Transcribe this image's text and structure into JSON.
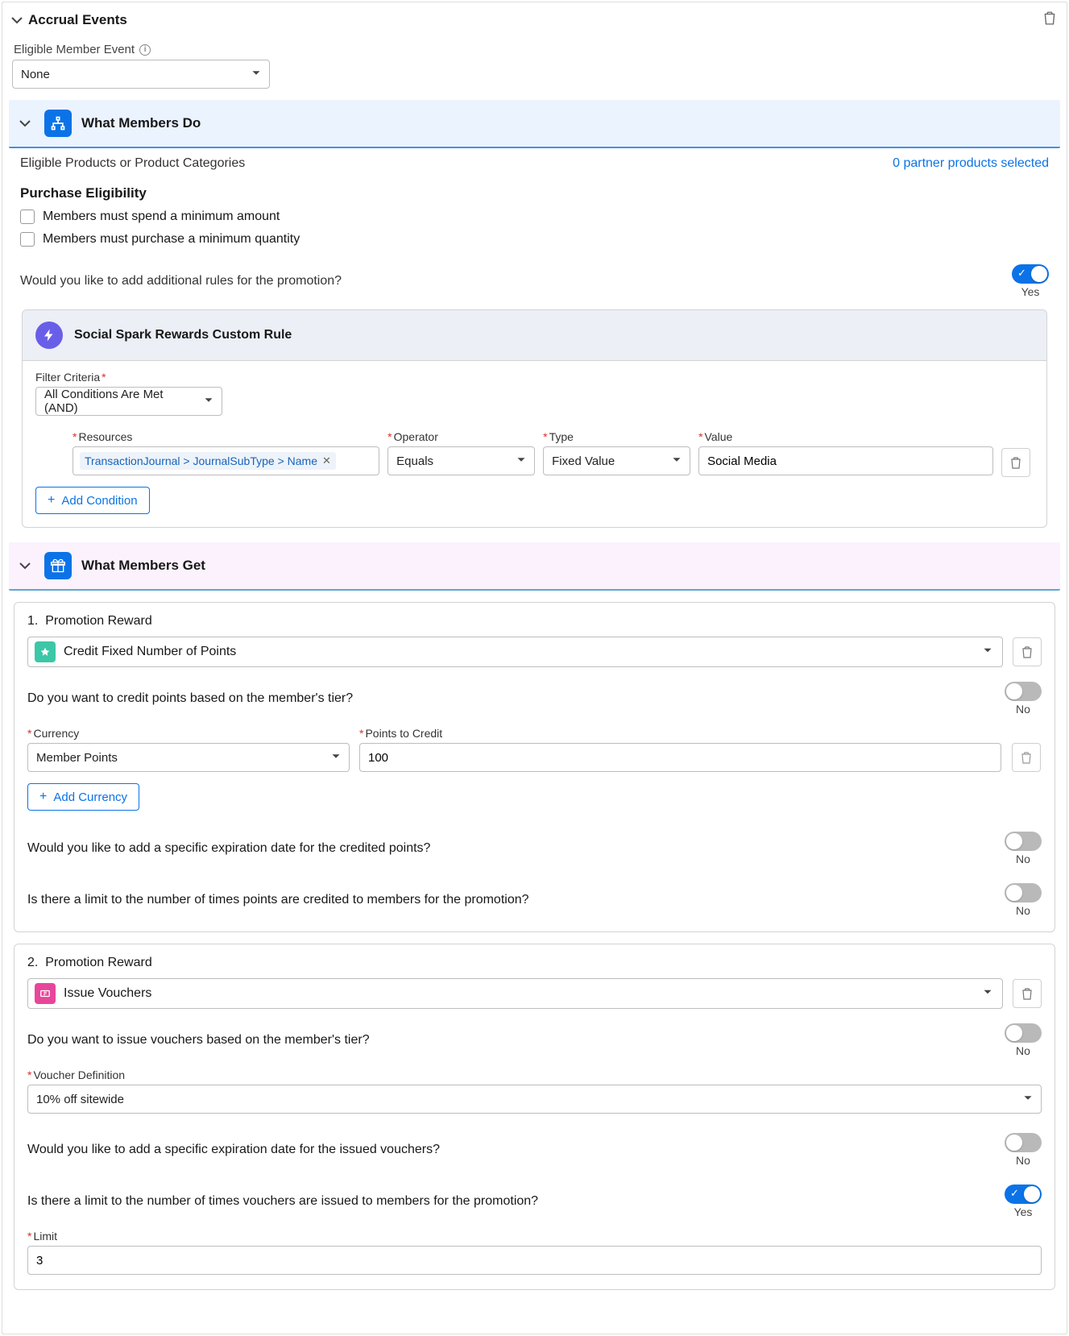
{
  "accrual": {
    "title": "Accrual Events",
    "eligible_member_event_label": "Eligible Member Event",
    "eligible_member_event_value": "None"
  },
  "members_do": {
    "title": "What Members Do",
    "eligible_products_label": "Eligible Products or Product Categories",
    "partner_link": "0 partner products selected",
    "purchase_heading": "Purchase Eligibility",
    "chk_min_spend": "Members must spend a minimum amount",
    "chk_min_qty": "Members must purchase a minimum quantity",
    "additional_rules_q": "Would you like to add additional rules for the promotion?",
    "additional_rules_val": "Yes"
  },
  "custom_rule": {
    "title": "Social Spark Rewards Custom Rule",
    "filter_criteria_label": "Filter Criteria",
    "filter_criteria_value": "All Conditions Are Met (AND)",
    "resources_label": "Resources",
    "resources_tag": "TransactionJournal > JournalSubType > Name",
    "operator_label": "Operator",
    "operator_value": "Equals",
    "type_label": "Type",
    "type_value": "Fixed Value",
    "value_label": "Value",
    "value_value": "Social Media",
    "add_condition": "Add Condition"
  },
  "members_get": {
    "title": "What Members Get"
  },
  "reward1": {
    "index": "1.",
    "label": "Promotion Reward",
    "select_value": "Credit Fixed Number of Points",
    "tier_q": "Do you want to credit points based on the member's tier?",
    "tier_val": "No",
    "currency_label": "Currency",
    "currency_value": "Member Points",
    "points_label": "Points to Credit",
    "points_value": "100",
    "add_currency": "Add Currency",
    "exp_q": "Would you like to add a specific expiration date for the credited points?",
    "exp_val": "No",
    "limit_q": "Is there a limit to the number of times points are credited to members for the promotion?",
    "limit_val": "No"
  },
  "reward2": {
    "index": "2.",
    "label": "Promotion Reward",
    "select_value": "Issue Vouchers",
    "tier_q": "Do you want to issue vouchers based on the member's tier?",
    "tier_val": "No",
    "voucher_def_label": "Voucher Definition",
    "voucher_def_value": "10% off sitewide",
    "exp_q": "Would you like to add a specific expiration date for the issued vouchers?",
    "exp_val": "No",
    "limit_q": "Is there a limit to the number of times vouchers are issued to members for the promotion?",
    "limit_val": "Yes",
    "limit_label": "Limit",
    "limit_value": "3"
  }
}
